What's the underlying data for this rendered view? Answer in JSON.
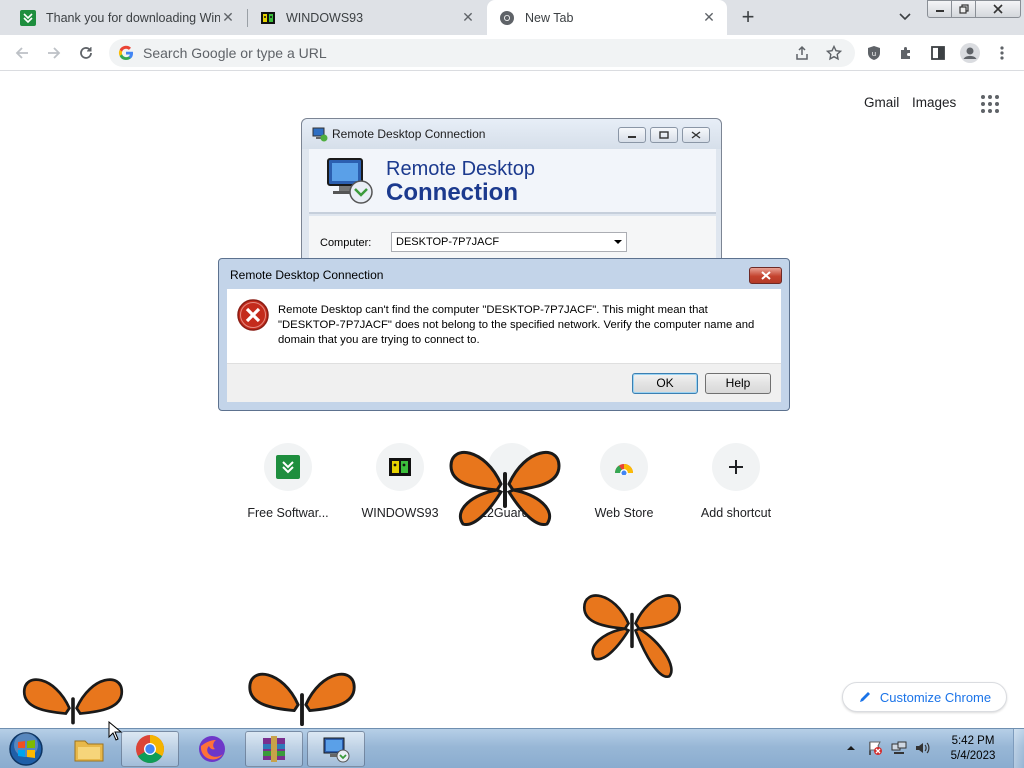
{
  "browser": {
    "tabs": [
      {
        "title": "Thank you for downloading WinR",
        "active": false
      },
      {
        "title": "WINDOWS93",
        "active": false
      },
      {
        "title": "New Tab",
        "active": true
      }
    ],
    "omnibox_placeholder": "Search Google or type a URL"
  },
  "ntp": {
    "links": [
      "Gmail",
      "Images"
    ],
    "shortcuts": [
      {
        "label": "Free Softwar..."
      },
      {
        "label": "WINDOWS93"
      },
      {
        "label": "E2Guardian"
      },
      {
        "label": "Web Store"
      },
      {
        "label": "Add shortcut"
      }
    ],
    "customize_label": "Customize Chrome"
  },
  "rdc_window": {
    "title": "Remote Desktop Connection",
    "banner_line1": "Remote Desktop",
    "banner_line2": "Connection",
    "computer_label": "Computer:",
    "computer_value": "DESKTOP-7P7JACF"
  },
  "error_dialog": {
    "title": "Remote Desktop Connection",
    "message": "Remote Desktop can't find the computer \"DESKTOP-7P7JACF\". This might mean that \"DESKTOP-7P7JACF\" does not belong to the specified network.  Verify the computer name and domain that you are trying to connect to.",
    "ok_label": "OK",
    "help_label": "Help"
  },
  "taskbar": {
    "apps": [
      "file-explorer",
      "chrome",
      "firefox",
      "winrar",
      "remote-desktop"
    ],
    "time": "5:42 PM",
    "date": "5/4/2023"
  },
  "colors": {
    "chrome_tabstrip": "#dee1e6",
    "link_blue": "#1a73e8",
    "rdc_title_blue": "#1c3a8e",
    "error_red": "#c4432f",
    "taskbar": "#98b7d6"
  }
}
